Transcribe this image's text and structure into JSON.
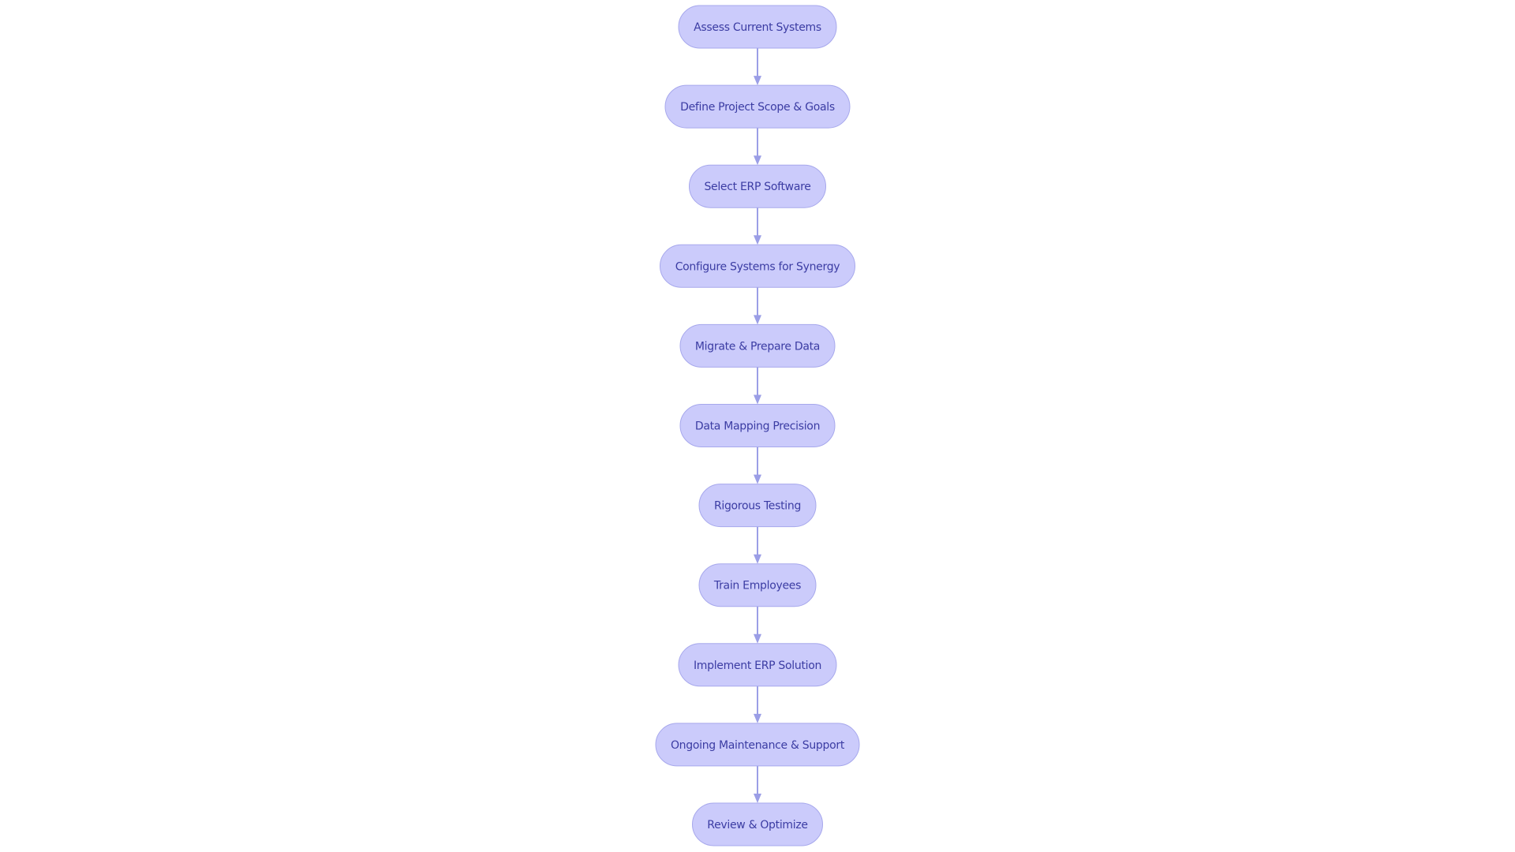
{
  "diagram": {
    "type": "flowchart",
    "direction": "top-to-bottom",
    "colors": {
      "node_fill": "#cbcbfb",
      "node_stroke": "#a7a8ec",
      "node_text": "#3b3ca3",
      "edge": "#9b9ee6"
    },
    "nodes": [
      {
        "id": "n1",
        "label": "Assess Current Systems"
      },
      {
        "id": "n2",
        "label": "Define Project Scope & Goals"
      },
      {
        "id": "n3",
        "label": "Select ERP Software"
      },
      {
        "id": "n4",
        "label": "Configure Systems for Synergy"
      },
      {
        "id": "n5",
        "label": "Migrate & Prepare Data"
      },
      {
        "id": "n6",
        "label": "Data Mapping Precision"
      },
      {
        "id": "n7",
        "label": "Rigorous Testing"
      },
      {
        "id": "n8",
        "label": "Train Employees"
      },
      {
        "id": "n9",
        "label": "Implement ERP Solution"
      },
      {
        "id": "n10",
        "label": "Ongoing Maintenance & Support"
      },
      {
        "id": "n11",
        "label": "Review & Optimize"
      }
    ],
    "edges": [
      {
        "from": "n1",
        "to": "n2"
      },
      {
        "from": "n2",
        "to": "n3"
      },
      {
        "from": "n3",
        "to": "n4"
      },
      {
        "from": "n4",
        "to": "n5"
      },
      {
        "from": "n5",
        "to": "n6"
      },
      {
        "from": "n6",
        "to": "n7"
      },
      {
        "from": "n7",
        "to": "n8"
      },
      {
        "from": "n8",
        "to": "n9"
      },
      {
        "from": "n9",
        "to": "n10"
      },
      {
        "from": "n10",
        "to": "n11"
      }
    ]
  }
}
